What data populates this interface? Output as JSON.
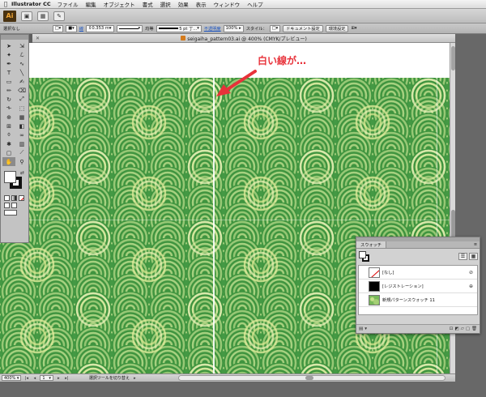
{
  "menubar": {
    "app": "Illustrator CC",
    "items": [
      "ファイル",
      "編集",
      "オブジェクト",
      "書式",
      "選択",
      "効果",
      "表示",
      "ウィンドウ",
      "ヘルプ"
    ]
  },
  "appbar": {
    "logo": "Ai"
  },
  "control": {
    "selection": "選択なし",
    "stroke_label": "線",
    "stroke_weight": "0.353 m",
    "profile": "均等",
    "brush": "5 pt 丁...",
    "opacity_label": "不透明度",
    "opacity": "100%",
    "style_label": "スタイル：",
    "doc_setup": "ドキュメント設定",
    "prefs": "環境設定"
  },
  "document": {
    "title": "seigaiha_pattern03.ai @ 400% (CMYK/プレビュー)"
  },
  "annotation": {
    "text": "白い線が…",
    "color": "#e8323a"
  },
  "status": {
    "zoom": "400%",
    "artboard": "1",
    "tool_hint": "選択ツールを切り替え"
  },
  "swatches": {
    "tab": "スウォッチ",
    "items": [
      {
        "name": "[なし]",
        "kind": "none"
      },
      {
        "name": "[レジストレーション]",
        "kind": "registration"
      },
      {
        "name": "新規パターンスウォッチ 11",
        "kind": "pattern"
      }
    ]
  },
  "colors": {
    "pattern_dark": "#3e9640",
    "pattern_mid": "#6fb45c",
    "pattern_light": "#cfe49a"
  }
}
